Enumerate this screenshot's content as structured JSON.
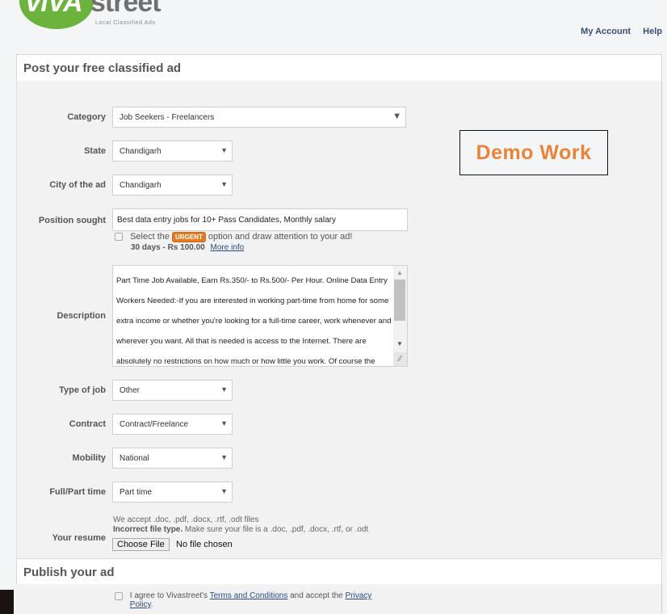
{
  "brand": {
    "logo_part1": "ViVA",
    "logo_part2": "street",
    "tagline": "Local Classified Ads",
    "colors": {
      "green": "#6cb33e",
      "grey": "#707070",
      "accent_orange": "#e07c22",
      "link": "#2a4b7c"
    }
  },
  "top_nav": {
    "my_account": "My Account",
    "help": "Help"
  },
  "post_section": {
    "title": "Post your free classified ad"
  },
  "form": {
    "category": {
      "label": "Category",
      "value": "Job Seekers - Freelancers",
      "icon": "chevron-down-icon"
    },
    "state": {
      "label": "State",
      "value": "Chandigarh"
    },
    "city": {
      "label": "City of the ad",
      "value": "Chandigarh"
    },
    "position": {
      "label": "Position sought",
      "value": "Best data entry jobs for 10+ Pass Candidates, Monthly salary"
    },
    "urgent": {
      "prefix": "Select the",
      "badge": "URGENT",
      "suffix": "option and draw attention to your ad!",
      "price": "30 days - Rs 100.00",
      "more_info": "More info",
      "checked": false
    },
    "description": {
      "label": "Description",
      "value": "Part Time Job Available, Earn Rs.350/- to Rs.500/- Per Hour.  Online Data Entry Workers Needed:-If you are interested in working part-time from home for some extra income or whether you're looking for a full-time career, work whenever and wherever you want. All that is needed is access to the Internet. There are absolutely no restrictions on how much or how little you work. Of course the"
    },
    "type_of_job": {
      "label": "Type of job",
      "value": "Other"
    },
    "contract": {
      "label": "Contract",
      "value": "Contract/Freelance"
    },
    "mobility": {
      "label": "Mobility",
      "value": "National"
    },
    "full_part_time": {
      "label": "Full/Part time",
      "value": "Part time"
    },
    "resume": {
      "label": "Your resume",
      "accepted": "We accept .doc, .pdf, .docx, .rtf, .odt files",
      "error_bold": "Incorrect file type.",
      "error_rest": "Make sure your file is a .doc, .pdf, .docx, .rtf, or .odt",
      "button": "Choose File",
      "status": "No file chosen"
    }
  },
  "overlay": {
    "demo_text": "Demo Work"
  },
  "publish_section": {
    "title": "Publish your ad",
    "agree_prefix": "I agree to Vivastreet's",
    "terms_link": "Terms and Conditions",
    "agree_middle": "and accept the",
    "privacy_link": "Privacy Policy",
    "agree_suffix": ".",
    "checked": false
  }
}
